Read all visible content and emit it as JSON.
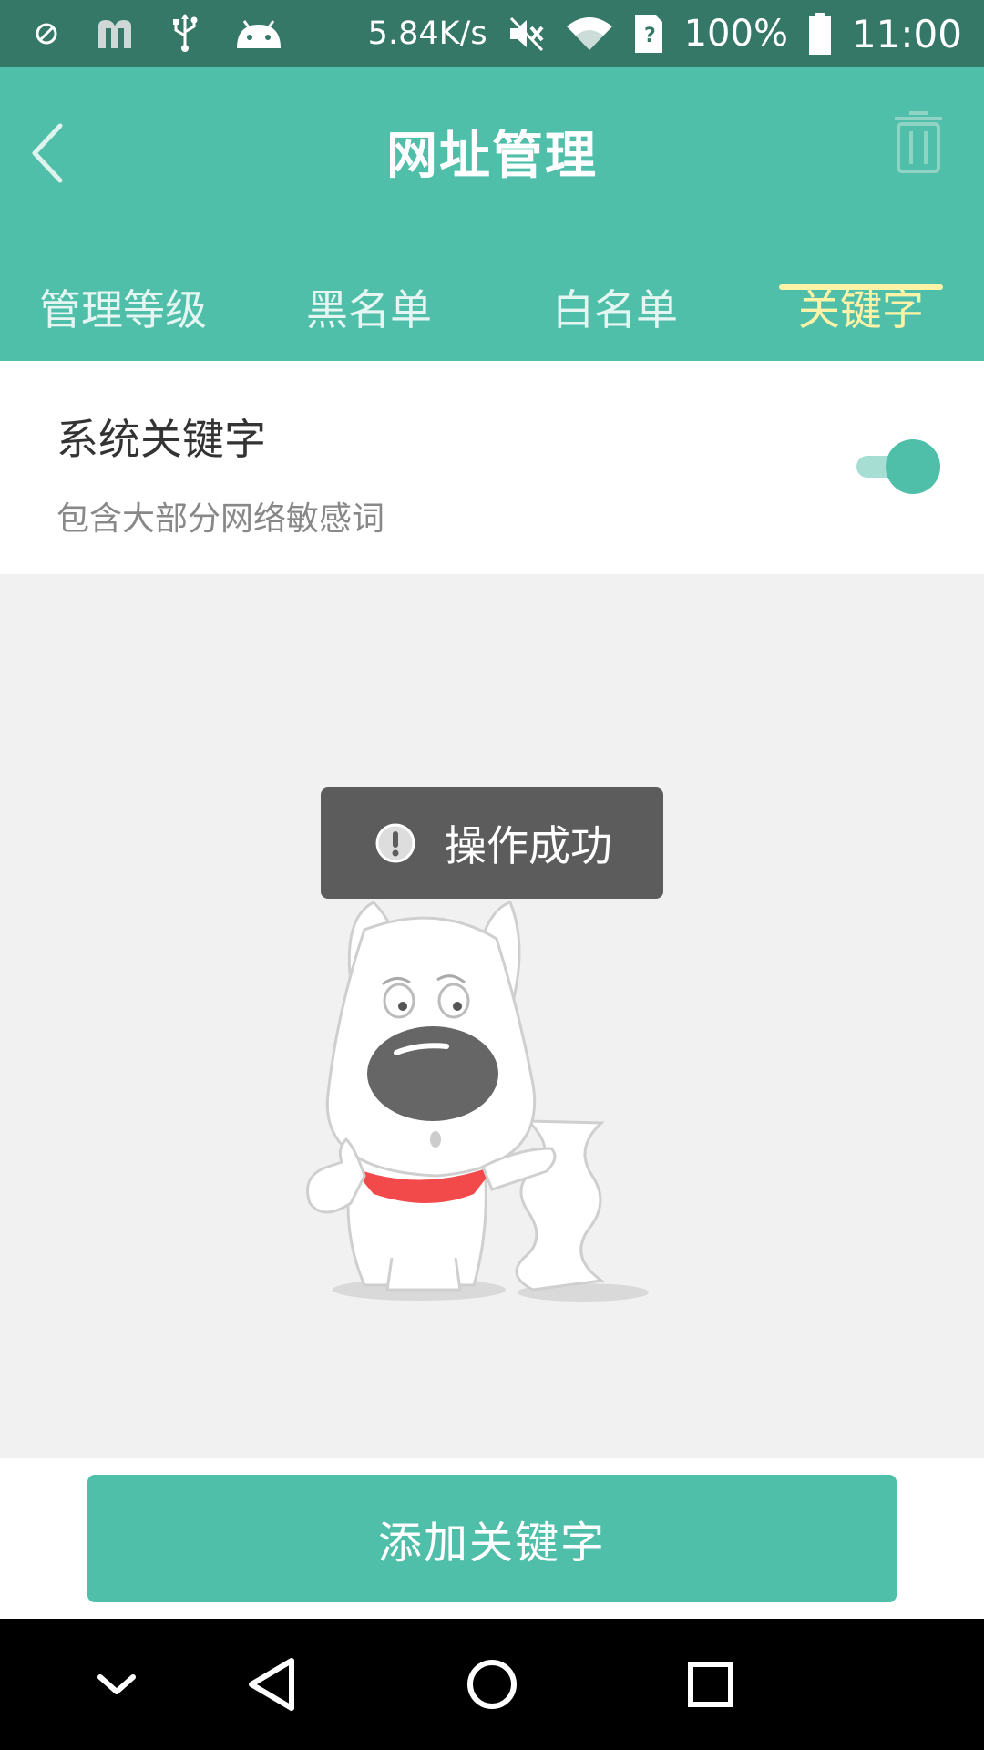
{
  "status_bar": {
    "network_speed": "5.84K/s",
    "battery": "100%",
    "time": "11:00",
    "icons": [
      "blocked-icon",
      "m-app-icon",
      "usb-icon",
      "android-icon",
      "mute-icon",
      "wifi-icon",
      "sim-unknown-icon",
      "battery-icon"
    ]
  },
  "header": {
    "title": "网址管理",
    "back_icon": "back-arrow-icon",
    "delete_icon": "trash-icon"
  },
  "tabs": [
    {
      "label": "管理等级",
      "active": false
    },
    {
      "label": "黑名单",
      "active": false
    },
    {
      "label": "白名单",
      "active": false
    },
    {
      "label": "关键字",
      "active": true
    }
  ],
  "keyword_setting": {
    "title": "系统关键字",
    "description": "包含大部分网络敏感词",
    "enabled": true
  },
  "toast": {
    "message": "操作成功",
    "icon": "exclamation-icon"
  },
  "bottom_button": {
    "label": "添加关键字"
  },
  "nav_bar": {
    "icons": [
      "chevron-down-icon",
      "back-triangle-icon",
      "home-circle-icon",
      "recents-square-icon"
    ]
  },
  "colors": {
    "status_bar": "#357868",
    "primary": "#4fbfaa",
    "active_tab": "#fff3a8",
    "toast_bg": "#5c5c5c"
  }
}
